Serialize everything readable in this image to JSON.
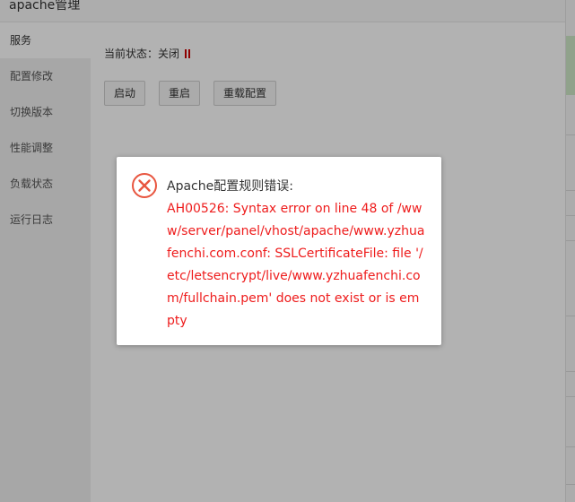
{
  "window": {
    "title": "apache管理"
  },
  "sidebar": {
    "items": [
      {
        "label": "服务",
        "active": true
      },
      {
        "label": "配置修改"
      },
      {
        "label": "切换版本"
      },
      {
        "label": "性能调整"
      },
      {
        "label": "负载状态"
      },
      {
        "label": "运行日志"
      }
    ]
  },
  "main": {
    "status_label": "当前状态：关闭",
    "buttons": {
      "start": "启动",
      "restart": "重启",
      "reload": "重载配置"
    }
  },
  "dialog": {
    "icon": "error-circle-x-icon",
    "heading": "Apache配置规则错误:",
    "error": "AH00526: Syntax error on line 48 of /www/server/panel/vhost/apache/www.yzhuafenchi.com.conf: SSLCertificateFile: file '/etc/letsencrypt/live/www.yzhuafenchi.com/fullchain.pem' does not exist or is empty"
  },
  "colors": {
    "error": "#ee1c1c",
    "status_stopped": "#cc0000",
    "overlay": "rgba(0,0,0,0.3)"
  }
}
